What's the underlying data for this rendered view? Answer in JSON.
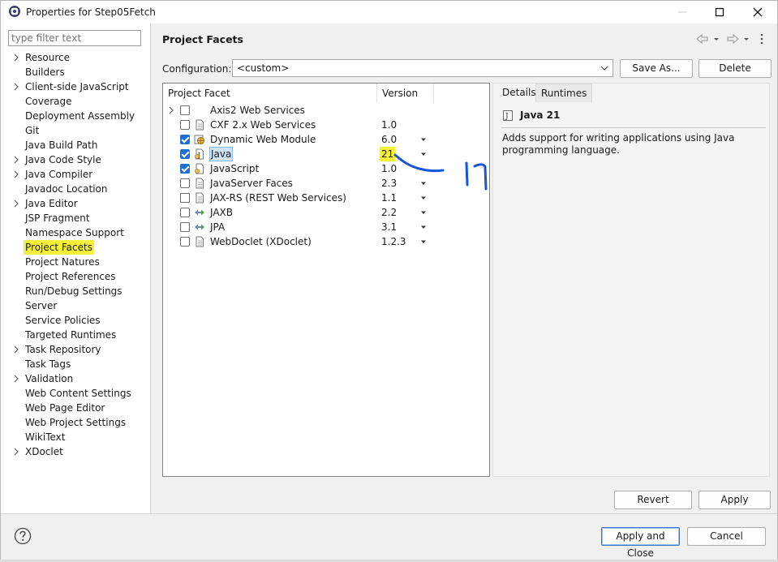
{
  "window": {
    "title": "Properties for Step05Fetch",
    "minimize_icon": "minimize-icon",
    "maximize_icon": "maximize-icon",
    "close_icon": "close-icon"
  },
  "filter": {
    "placeholder": "type filter text",
    "value": ""
  },
  "tree": [
    {
      "label": "Resource",
      "expandable": true
    },
    {
      "label": "Builders",
      "expandable": false
    },
    {
      "label": "Client-side JavaScript",
      "expandable": true
    },
    {
      "label": "Coverage",
      "expandable": false
    },
    {
      "label": "Deployment Assembly",
      "expandable": false
    },
    {
      "label": "Git",
      "expandable": false
    },
    {
      "label": "Java Build Path",
      "expandable": false
    },
    {
      "label": "Java Code Style",
      "expandable": true
    },
    {
      "label": "Java Compiler",
      "expandable": true
    },
    {
      "label": "Javadoc Location",
      "expandable": false
    },
    {
      "label": "Java Editor",
      "expandable": true
    },
    {
      "label": "JSP Fragment",
      "expandable": false
    },
    {
      "label": "Namespace Support",
      "expandable": false
    },
    {
      "label": "Project Facets",
      "expandable": false,
      "selected": true
    },
    {
      "label": "Project Natures",
      "expandable": false
    },
    {
      "label": "Project References",
      "expandable": false
    },
    {
      "label": "Run/Debug Settings",
      "expandable": false
    },
    {
      "label": "Server",
      "expandable": false
    },
    {
      "label": "Service Policies",
      "expandable": false
    },
    {
      "label": "Targeted Runtimes",
      "expandable": false
    },
    {
      "label": "Task Repository",
      "expandable": true
    },
    {
      "label": "Task Tags",
      "expandable": false
    },
    {
      "label": "Validation",
      "expandable": true
    },
    {
      "label": "Web Content Settings",
      "expandable": false
    },
    {
      "label": "Web Page Editor",
      "expandable": false
    },
    {
      "label": "Web Project Settings",
      "expandable": false
    },
    {
      "label": "WikiText",
      "expandable": false
    },
    {
      "label": "XDoclet",
      "expandable": true
    }
  ],
  "main": {
    "title": "Project Facets",
    "configuration_label": "Configuration:",
    "configuration_value": "<custom>",
    "save_as_label": "Save As...",
    "delete_label": "Delete",
    "columns": [
      "Project Facet",
      "Version"
    ],
    "facets": [
      {
        "name": "Axis2 Web Services",
        "version": "",
        "checked": false,
        "expandable": true,
        "dropdown": false,
        "icon": "none"
      },
      {
        "name": "CXF 2.x Web Services",
        "version": "1.0",
        "checked": false,
        "expandable": false,
        "dropdown": false,
        "icon": "page-icon"
      },
      {
        "name": "Dynamic Web Module",
        "version": "6.0",
        "checked": true,
        "expandable": false,
        "dropdown": true,
        "icon": "web-module-icon"
      },
      {
        "name": "Java",
        "version": "21",
        "checked": true,
        "expandable": false,
        "dropdown": true,
        "icon": "java-icon",
        "selected": true,
        "highlight": true
      },
      {
        "name": "JavaScript",
        "version": "1.0",
        "checked": true,
        "expandable": false,
        "dropdown": false,
        "icon": "javascript-icon"
      },
      {
        "name": "JavaServer Faces",
        "version": "2.3",
        "checked": false,
        "expandable": false,
        "dropdown": true,
        "icon": "page-icon"
      },
      {
        "name": "JAX-RS (REST Web Services)",
        "version": "1.1",
        "checked": false,
        "expandable": false,
        "dropdown": true,
        "icon": "page-icon"
      },
      {
        "name": "JAXB",
        "version": "2.2",
        "checked": false,
        "expandable": false,
        "dropdown": true,
        "icon": "jaxb-icon"
      },
      {
        "name": "JPA",
        "version": "3.1",
        "checked": false,
        "expandable": false,
        "dropdown": true,
        "icon": "jpa-icon"
      },
      {
        "name": "WebDoclet (XDoclet)",
        "version": "1.2.3",
        "checked": false,
        "expandable": false,
        "dropdown": true,
        "icon": "page-icon"
      }
    ],
    "tabs": [
      "Details",
      "Runtimes"
    ],
    "details_title": "Java 21",
    "details_desc": "Adds support for writing applications using Java programming language.",
    "revert_label": "Revert",
    "apply_label": "Apply"
  },
  "footer": {
    "help_icon": "help-icon",
    "apply_close_label": "Apply and Close",
    "cancel_label": "Cancel"
  },
  "colors": {
    "highlight": "#f5f03a",
    "checkbox": "#1f6fd1",
    "annotation": "#1856d6"
  }
}
